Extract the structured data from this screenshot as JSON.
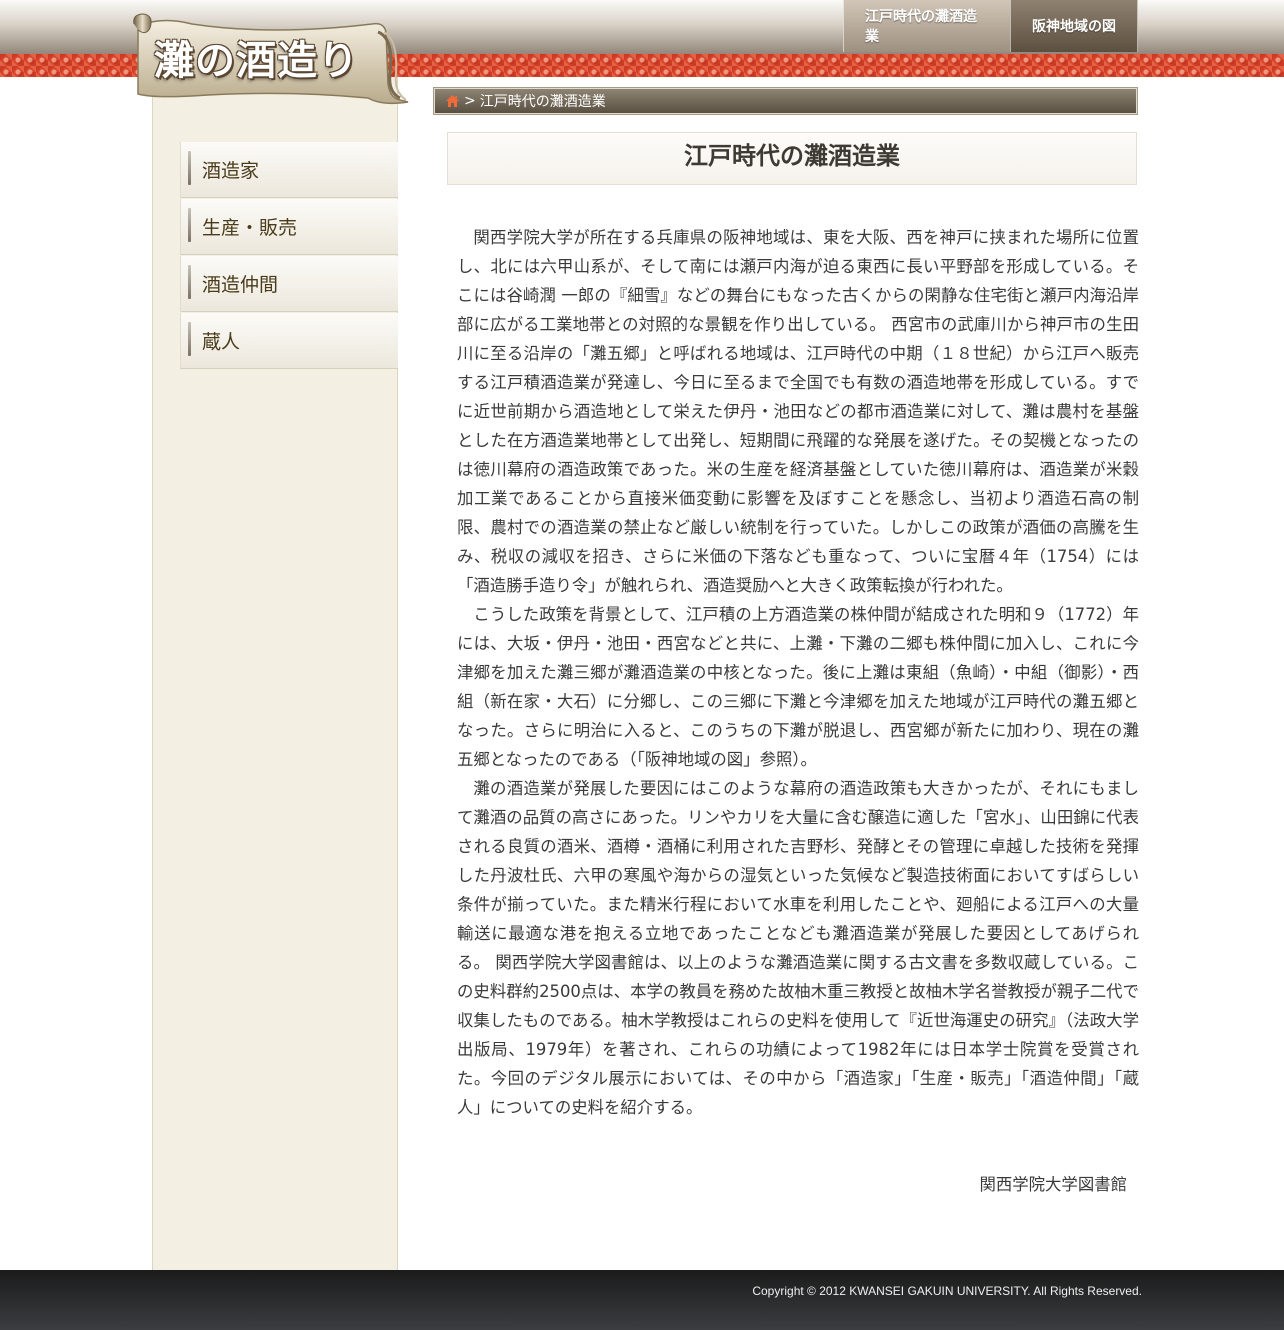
{
  "header": {
    "logo_text": "灘の酒造り",
    "nav": [
      {
        "label": "江戸時代の灘酒造業"
      },
      {
        "label": "阪神地域の図"
      }
    ]
  },
  "sidebar": {
    "items": [
      {
        "label": "酒造家"
      },
      {
        "label": "生産・販売"
      },
      {
        "label": "酒造仲間"
      },
      {
        "label": "蔵人"
      }
    ]
  },
  "breadcrumb": {
    "home_icon": "home-icon",
    "separator": ">",
    "current": "江戸時代の灘酒造業"
  },
  "main": {
    "title": "江戸時代の灘酒造業",
    "paragraphs": [
      "関西学院大学が所在する兵庫県の阪神地域は、東を大阪、西を神戸に挟まれた場所に位置し、北には六甲山系が、そして南には瀬戸内海が迫る東西に長い平野部を形成している。そこには谷崎潤 一郎の『細雪』などの舞台にもなった古くからの閑静な住宅街と瀬戸内海沿岸部に広がる工業地帯との対照的な景観を作り出している。 西宮市の武庫川から神戸市の生田川に至る沿岸の「灘五郷」と呼ばれる地域は、江戸時代の中期（１８世紀）から江戸へ販売する江戸積酒造業が発達し、今日に至るまで全国でも有数の酒造地帯を形成している。すでに近世前期から酒造地として栄えた伊丹・池田などの都市酒造業に対して、灘は農村を基盤とした在方酒造業地帯として出発し、短期間に飛躍的な発展を遂げた。その契機となったのは徳川幕府の酒造政策であった。米の生産を経済基盤としていた徳川幕府は、酒造業が米穀加工業であることから直接米価変動に影響を及ぼすことを懸念し、当初より酒造石高の制限、農村での酒造業の禁止など厳しい統制を行っていた。しかしこの政策が酒価の高騰を生み、税収の減収を招き、さらに米価の下落なども重なって、ついに宝暦４年（1754）には「酒造勝手造り令」が触れられ、酒造奨励へと大きく政策転換が行われた。",
      "こうした政策を背景として、江戸積の上方酒造業の株仲間が結成された明和９（1772）年には、大坂・伊丹・池田・西宮などと共に、上灘・下灘の二郷も株仲間に加入し、これに今津郷を加えた灘三郷が灘酒造業の中核となった。後に上灘は東組（魚崎）・中組（御影）・西組（新在家・大石）に分郷し、この三郷に下灘と今津郷を加えた地域が江戸時代の灘五郷となった。さらに明治に入ると、このうちの下灘が脱退し、西宮郷が新たに加わり、現在の灘五郷となったのである（「阪神地域の図」参照）。",
      "灘の酒造業が発展した要因にはこのような幕府の酒造政策も大きかったが、それにもまして灘酒の品質の高さにあった。リンやカリを大量に含む醸造に適した「宮水」、山田錦に代表される良質の酒米、酒樽・酒桶に利用された吉野杉、発酵とその管理に卓越した技術を発揮した丹波杜氏、六甲の寒風や海からの湿気といった気候など製造技術面においてすばらしい条件が揃っていた。また精米行程において水車を利用したことや、廻船による江戸への大量輸送に最適な港を抱える立地であったことなども灘酒造業が発展した要因としてあげられる。 関西学院大学図書館は、以上のような灘酒造業に関する古文書を多数収蔵している。この史料群約2500点は、本学の教員を務めた故柚木重三教授と故柚木学名誉教授が親子二代で収集したものである。柚木学教授はこれらの史料を使用して『近世海運史の研究』（法政大学出版局、1979年）を著され、これらの功績によって1982年には日本学士院賞を受賞された。今回のデジタル展示においては、その中から「酒造家」「生産・販売」「酒造仲間」「蔵人」についての史料を紹介する。"
    ],
    "signature": "関西学院大学図書館"
  },
  "footer": {
    "copyright": "Copyright © 2012 KWANSEI GAKUIN UNIVERSITY. All Rights Reserved."
  },
  "colors": {
    "accent_red": "#d9442a",
    "sidebar_bg": "#f3efe3",
    "breadcrumb_bg": "#6f6555",
    "footer_bg": "#2a2b2d"
  }
}
